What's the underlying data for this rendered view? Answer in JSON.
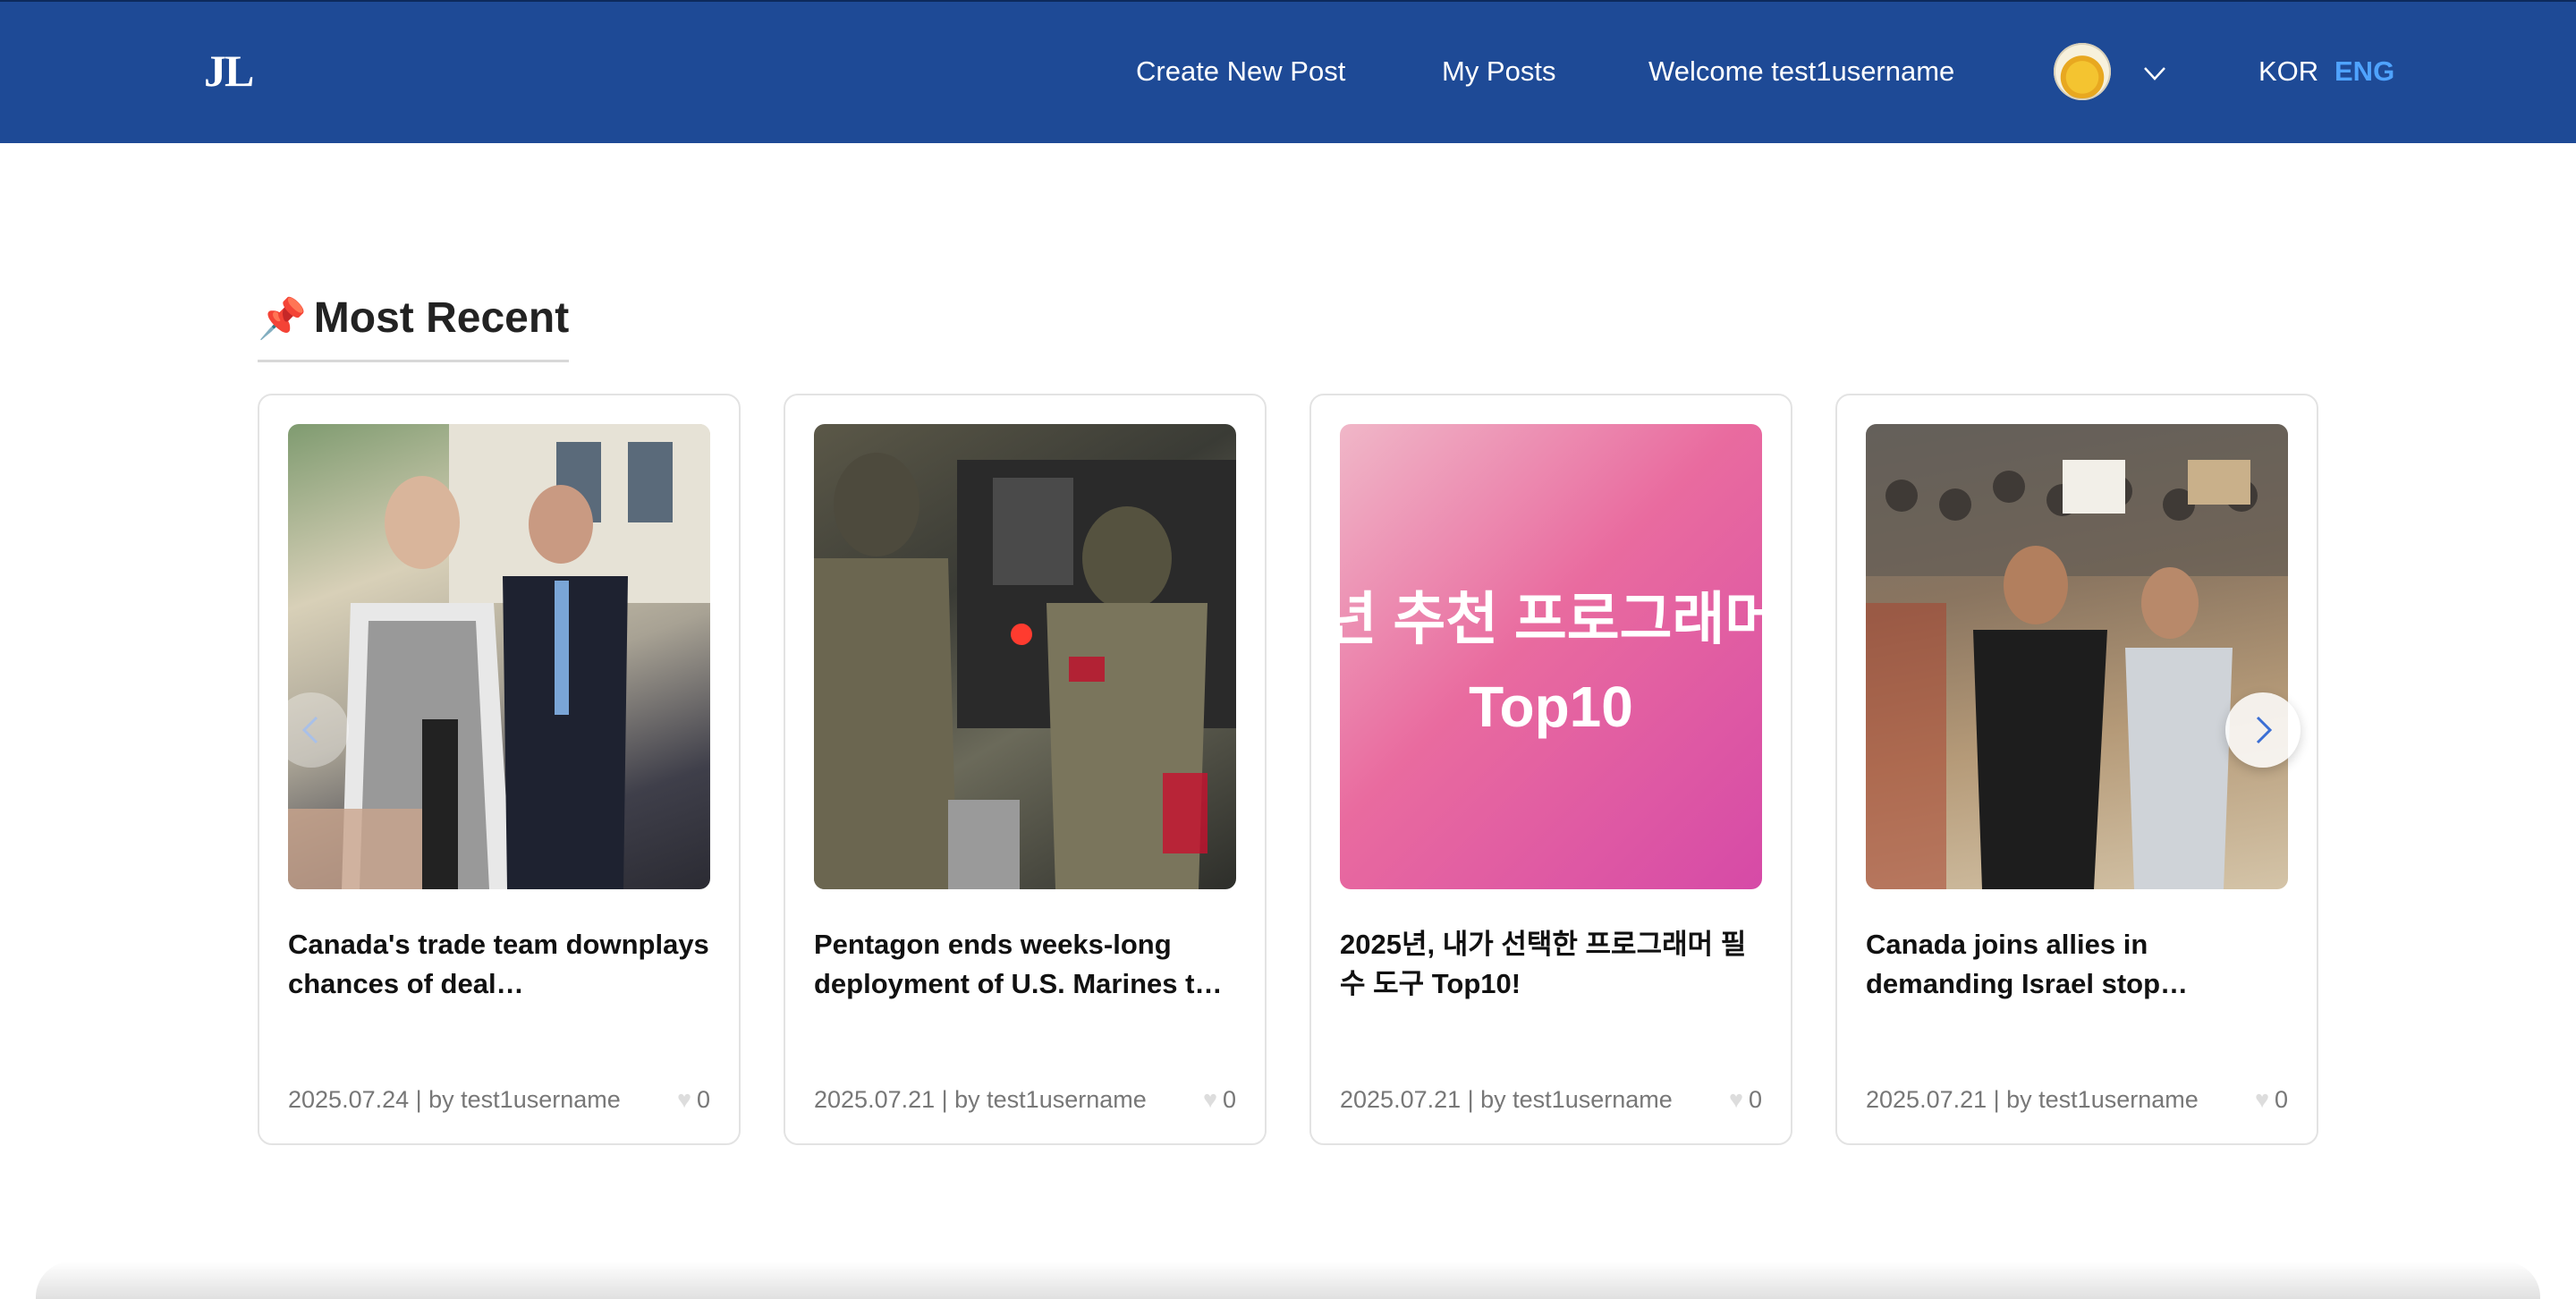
{
  "header": {
    "logo": "JL",
    "nav": {
      "create_post": "Create New Post",
      "my_posts": "My Posts",
      "welcome": "Welcome test1username"
    },
    "languages": {
      "kor": "KOR",
      "eng": "ENG",
      "active": "ENG"
    }
  },
  "section": {
    "title": "Most Recent",
    "icon": "pin-icon"
  },
  "posts": [
    {
      "title": "Canada's trade team downplays chances of deal…",
      "date": "2025.07.24",
      "author": "test1username",
      "meta": "2025.07.24 | by test1username",
      "likes": "0"
    },
    {
      "title": "Pentagon ends weeks-long deployment of U.S. Marines t…",
      "date": "2025.07.21",
      "author": "test1username",
      "meta": "2025.07.21 | by test1username",
      "likes": "0"
    },
    {
      "title": "2025년, 내가 선택한 프로그래머 필수 도구 Top10!",
      "date": "2025.07.21",
      "author": "test1username",
      "meta": "2025.07.21 | by test1username",
      "likes": "0",
      "image_text": [
        "년 추천 프로그래머",
        "Top10"
      ]
    },
    {
      "title": "Canada joins allies in demanding Israel stop…",
      "date": "2025.07.21",
      "author": "test1username",
      "meta": "2025.07.21 | by test1username",
      "likes": "0"
    }
  ],
  "colors": {
    "header_bg": "#1e4a96",
    "active_lang": "#4fa3ff",
    "arrow": "#3b6fd4"
  }
}
